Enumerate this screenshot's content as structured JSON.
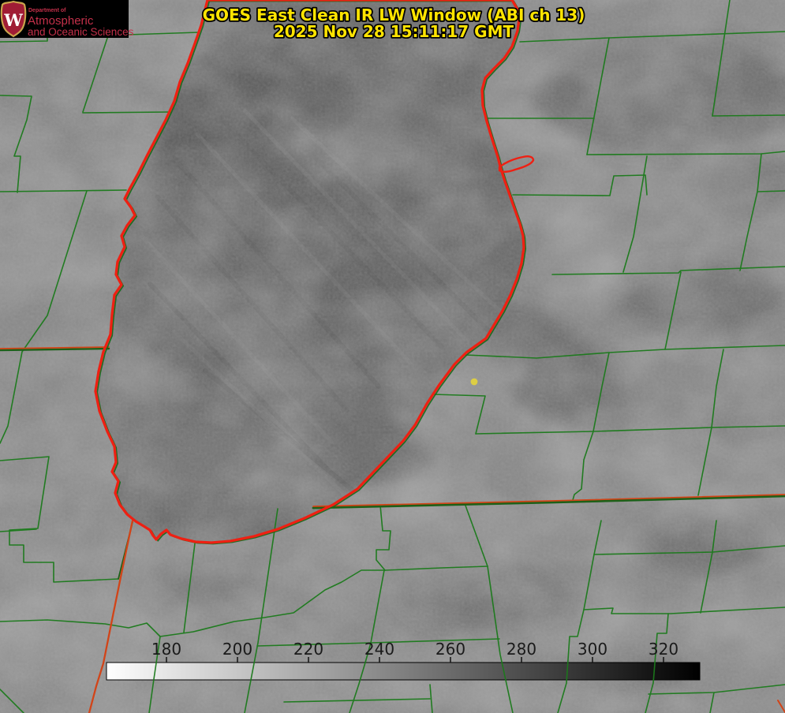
{
  "header": {
    "title_line1": "GOES East Clean IR LW Window (ABI ch 13)",
    "title_line2": "2025 Nov 28 15:11:17 GMT",
    "title_color": "#ffe400"
  },
  "logo": {
    "dept_line": "Department of",
    "name_line1": "Atmospheric",
    "name_line2": "and Oceanic Sciences",
    "crest_letter": "W",
    "text_color": "#c4304a",
    "crest_fill": "#a01c35",
    "crest_border": "#c9a34c",
    "crest_letter_color": "#ffffff",
    "bg_color": "#000000"
  },
  "colorbar": {
    "labels": [
      "180",
      "200",
      "220",
      "240",
      "260",
      "280",
      "300",
      "320"
    ],
    "gradient_start": "#ffffff",
    "gradient_end": "#000000",
    "label_color": "#1a1a1a",
    "tick_color": "#111111"
  },
  "map": {
    "colors": {
      "land": "#8a8a8a",
      "lake": "#6d6d6d",
      "county_line": "#1b7a1b",
      "state_line_red": "#d24418",
      "shoreline_red": "#ee2013",
      "marker_dot": "#ddce44"
    }
  }
}
